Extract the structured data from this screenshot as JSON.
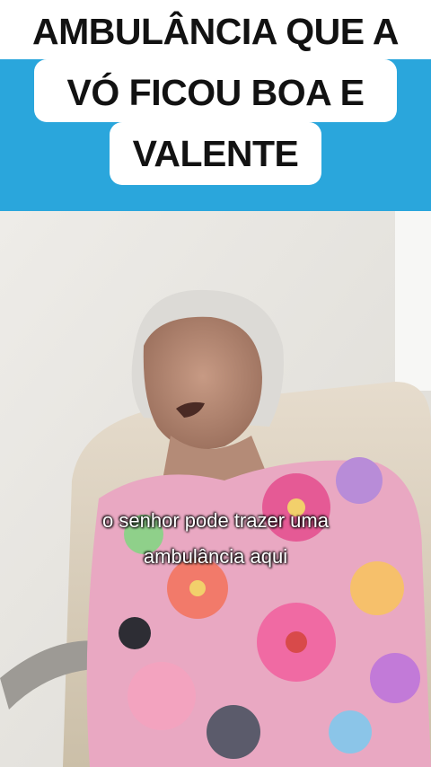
{
  "title": {
    "lines": [
      "AMBULÂNCIA QUE A",
      "VÓ FICOU BOA E",
      "VALENTE"
    ]
  },
  "video": {
    "subtitle_lines": [
      "o senhor pode trazer uma",
      "ambulância aqui"
    ]
  },
  "colors": {
    "banner_blue": "#2aa6dc",
    "title_text": "#121212",
    "subtitle_text": "#ffffff"
  }
}
